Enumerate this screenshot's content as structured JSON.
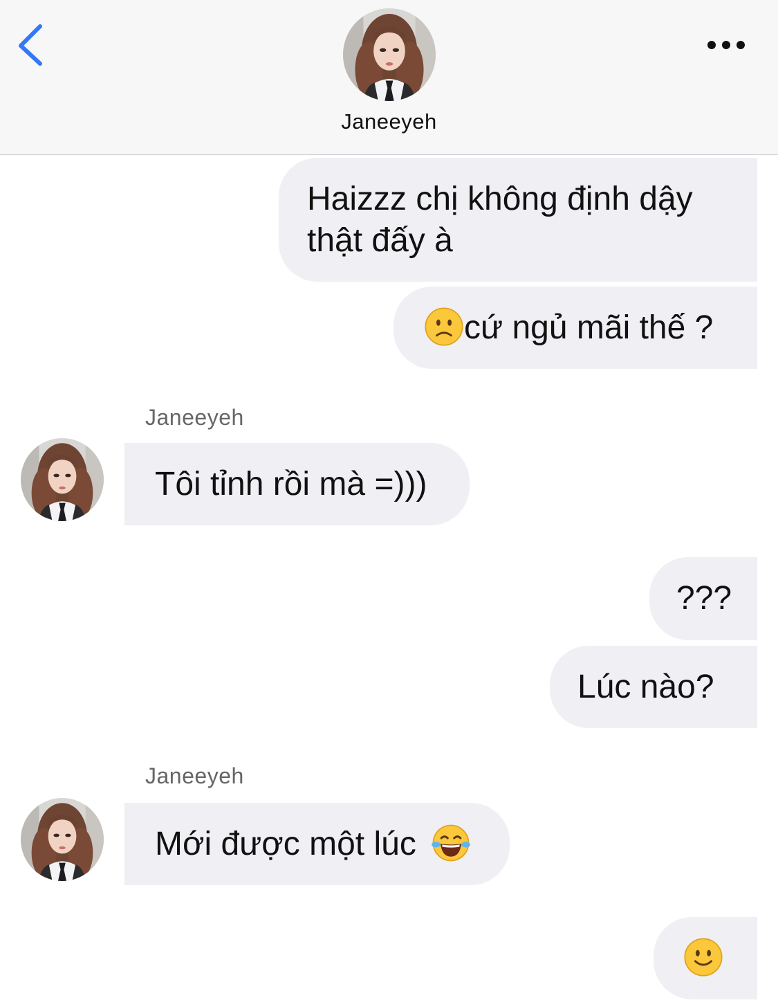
{
  "header": {
    "contact_name": "Janeeyeh"
  },
  "icons": {
    "back": "chevron-left-icon",
    "more": "ellipsis-icon",
    "frown": "slightly-frowning-face-emoji",
    "laugh": "face-with-tears-of-joy-emoji",
    "smile": "slightly-smiling-face-emoji"
  },
  "colors": {
    "accent": "#3478f6",
    "bubble": "#efeff4",
    "header_bg": "#f7f7f7"
  },
  "messages": [
    {
      "from": "me",
      "lines": [
        "Haizzz chị không định dậy",
        "thật đấy à"
      ]
    },
    {
      "from": "me",
      "text": "cứ ngủ mãi thế ?",
      "emoji": "slightly-frowning-face-emoji"
    },
    {
      "from": "contact",
      "sender": "Janeeyeh",
      "text": "Tôi tỉnh rồi mà =)))"
    },
    {
      "from": "me",
      "text": "???"
    },
    {
      "from": "me",
      "text": "Lúc nào?"
    },
    {
      "from": "contact",
      "sender": "Janeeyeh",
      "text": "Mới được một lúc",
      "emoji": "face-with-tears-of-joy-emoji"
    },
    {
      "from": "me",
      "emoji": "slightly-smiling-face-emoji"
    }
  ]
}
